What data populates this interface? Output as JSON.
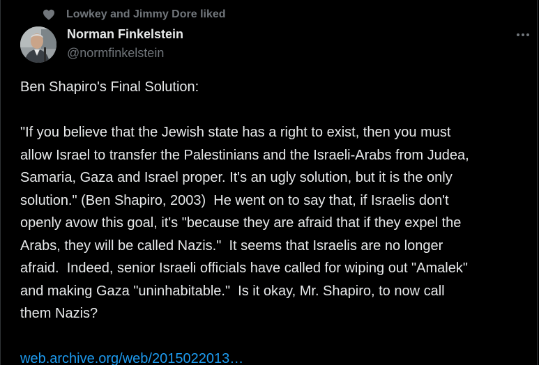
{
  "social_context": {
    "icon": "heart-icon",
    "text": "Lowkey and Jimmy Dore liked"
  },
  "author": {
    "display_name": "Norman Finkelstein",
    "handle": "@normfinkelstein",
    "avatar_icon": "avatar"
  },
  "more_icon": "more-icon",
  "tweet": {
    "body": "Ben Shapiro's Final Solution:\n\n\"If you believe that the Jewish state has a right to exist, then you must\nallow Israel to transfer the Palestinians and the Israeli-Arabs from Judea,\nSamaria, Gaza and Israel proper. It's an ugly solution, but it is the only\nsolution.\" (Ben Shapiro, 2003)  He went on to say that, if Israelis don't\nopenly avow this goal, it's \"because they are afraid that if they expel the\nArabs, they will be called Nazis.\"  It seems that Israelis are no longer\nafraid.  Indeed, senior Israeli officials have called for wiping out \"Amalek\"\nand making Gaza \"uninhabitable.\"  Is it okay, Mr. Shapiro, to now call\nthem Nazis?\n\n",
    "link": "web.archive.org/web/2015022013…"
  },
  "colors": {
    "background": "#000000",
    "text": "#e7e9ea",
    "secondary": "#71767b",
    "link": "#1d9bf0"
  }
}
